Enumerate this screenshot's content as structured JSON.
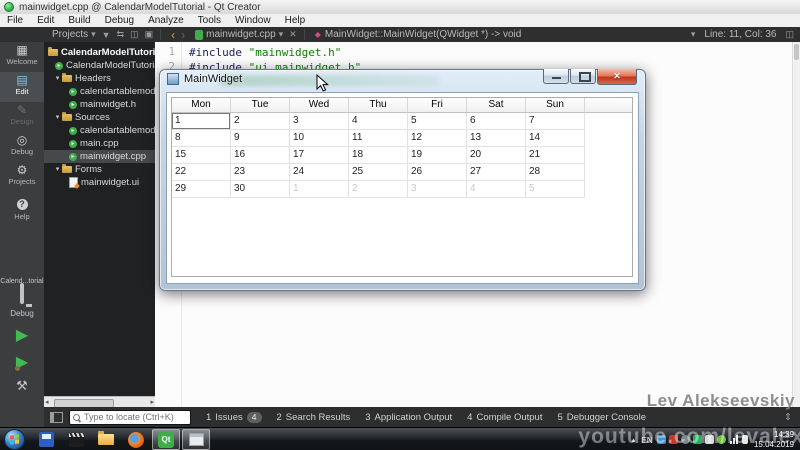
{
  "window": {
    "title": "mainwidget.cpp @ CalendarModelTutorial - Qt Creator"
  },
  "menu": {
    "items": [
      "File",
      "Edit",
      "Build",
      "Debug",
      "Analyze",
      "Tools",
      "Window",
      "Help"
    ]
  },
  "toolbar": {
    "panel_selector": "Projects",
    "open_document": "mainwidget.cpp",
    "symbol_signature": "MainWidget::MainWidget(QWidget *) -> void",
    "line_col": "Line: 11, Col: 36"
  },
  "mode_sidebar": {
    "items": [
      {
        "label": "Welcome"
      },
      {
        "label": "Edit"
      },
      {
        "label": "Design"
      },
      {
        "label": "Debug"
      },
      {
        "label": "Projects"
      },
      {
        "label": "Help"
      }
    ],
    "target": {
      "project": "Calend...torial",
      "mode": "Debug"
    }
  },
  "project_tree": {
    "items": [
      {
        "label": "CalendarModelTutorial"
      },
      {
        "label": "CalendarModelTutorial.pro"
      },
      {
        "label": "Headers"
      },
      {
        "label": "calendartablemodel.h"
      },
      {
        "label": "mainwidget.h"
      },
      {
        "label": "Sources"
      },
      {
        "label": "calendartablemodel.cpp"
      },
      {
        "label": "main.cpp"
      },
      {
        "label": "mainwidget.cpp"
      },
      {
        "label": "Forms"
      },
      {
        "label": "mainwidget.ui"
      }
    ]
  },
  "editor": {
    "lines": [
      {
        "num": "1",
        "directive": "#include",
        "string": "\"mainwidget.h\""
      },
      {
        "num": "2",
        "directive": "#include",
        "string": "\"ui_mainwidget.h\""
      }
    ]
  },
  "app_window": {
    "title": "MainWidget",
    "calendar": {
      "headers": [
        "Mon",
        "Tue",
        "Wed",
        "Thu",
        "Fri",
        "Sat",
        "Sun"
      ],
      "rows": [
        [
          "1",
          "2",
          "3",
          "4",
          "5",
          "6",
          "7"
        ],
        [
          "8",
          "9",
          "10",
          "11",
          "12",
          "13",
          "14"
        ],
        [
          "15",
          "16",
          "17",
          "18",
          "19",
          "20",
          "21"
        ],
        [
          "22",
          "23",
          "24",
          "25",
          "26",
          "27",
          "28"
        ],
        [
          "29",
          "30",
          "1",
          "2",
          "3",
          "4",
          "5"
        ]
      ]
    }
  },
  "status_bar": {
    "locate_placeholder": "Type to locate (Ctrl+K)",
    "panes": [
      {
        "num": "1",
        "label": "Issues",
        "badge": "4"
      },
      {
        "num": "2",
        "label": "Search Results"
      },
      {
        "num": "3",
        "label": "Application Output"
      },
      {
        "num": "4",
        "label": "Compile Output"
      },
      {
        "num": "5",
        "label": "Debugger Console"
      }
    ]
  },
  "taskbar": {
    "tray_language": "EN",
    "clock_time": "14:39",
    "clock_date": "15.04.2019"
  },
  "watermark": {
    "name": "Lev Alekseevskiy",
    "url": "youtube.com/levalex"
  },
  "icons": {
    "dropdown_arrow": "▾",
    "filter": "▼",
    "link": "⇆",
    "split": "◫",
    "diff": "▣",
    "back": "‹",
    "forward": "›",
    "close": "✕",
    "welcome": "▦",
    "edit": "▤",
    "design": "✎",
    "debug_mode": "◎",
    "projects_mode": "⚙",
    "help": "?",
    "run": "▶",
    "build": "⚒",
    "expander": "▾",
    "pane_arrows": "⇕",
    "scroll_left": "◂",
    "scroll_right": "▸",
    "tray_expand": "▴",
    "qt_logo": "Qt",
    "close_window": "✕"
  },
  "colors": {
    "accent_green": "#3fae49",
    "string_green": "#0e7d00",
    "preprocessor": "#202060",
    "close_red": "#c1371c",
    "dark_chrome": "#2d2f31",
    "panel_dark": "#1f2123"
  }
}
